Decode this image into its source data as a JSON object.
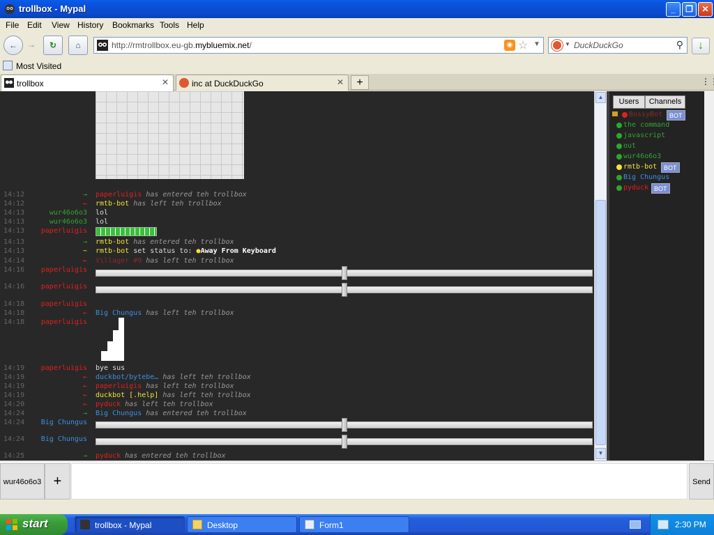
{
  "window": {
    "title": "trollbox - Mypal"
  },
  "menu": [
    "File",
    "Edit",
    "View",
    "History",
    "Bookmarks",
    "Tools",
    "Help"
  ],
  "url": {
    "prefix": "http://rmtrollbox.eu-gb.",
    "domain": "mybluemix.net",
    "suffix": "/"
  },
  "search": {
    "placeholder": "DuckDuckGo"
  },
  "bookmarks": {
    "most_visited": "Most Visited"
  },
  "tabs": [
    {
      "label": "trollbox",
      "active": true
    },
    {
      "label": "inc at DuckDuckGo",
      "active": false
    }
  ],
  "chat": {
    "messages": [
      {
        "time": "14:12",
        "arrow": "→",
        "nick": "paperluigis",
        "text": "has entered teh trollbox"
      },
      {
        "time": "14:12",
        "arrow": "←",
        "nick": "rmtb-bot",
        "text": "has left teh trollbox"
      },
      {
        "time": "14:13",
        "nick": "wur46o6o3",
        "text": "lol"
      },
      {
        "time": "14:13",
        "nick": "wur46o6o3",
        "text": "lol"
      },
      {
        "time": "14:13",
        "nick": "paperluigis",
        "text": ""
      },
      {
        "time": "14:13",
        "arrow": "→",
        "nick": "rmtb-bot",
        "text": "has entered teh trollbox"
      },
      {
        "time": "14:13",
        "arrow": "~",
        "nick": "rmtb-bot",
        "text": "set status to:",
        "status": "Away From Keyboard"
      },
      {
        "time": "14:14",
        "arrow": "←",
        "nick": "Villager #9",
        "text": "has left teh trollbox"
      },
      {
        "time": "14:16",
        "nick": "paperluigis",
        "text": ""
      },
      {
        "time": "14:16",
        "nick": "paperluigis",
        "text": ""
      },
      {
        "time": "14:18",
        "nick": "paperluigis",
        "text": ""
      },
      {
        "time": "14:18",
        "arrow": "←",
        "nick": "Big Chungus",
        "text": "has left teh trollbox"
      },
      {
        "time": "14:18",
        "nick": "paperluigis",
        "text": ""
      },
      {
        "time": "14:19",
        "nick": "paperluigis",
        "text": "bye sus"
      },
      {
        "time": "14:19",
        "arrow": "←",
        "nick": "duckbot/bytebe…",
        "text": "has left teh trollbox"
      },
      {
        "time": "14:19",
        "arrow": "←",
        "nick": "paperluigis",
        "text": "has left teh trollbox"
      },
      {
        "time": "14:19",
        "arrow": "←",
        "nick": "duckbot [.help]",
        "text": "has left teh trollbox"
      },
      {
        "time": "14:20",
        "arrow": "←",
        "nick": "pyduck",
        "text": "has left teh trollbox"
      },
      {
        "time": "14:24",
        "arrow": "→",
        "nick": "Big Chungus",
        "text": "has entered teh trollbox"
      },
      {
        "time": "14:24",
        "nick": "Big Chungus",
        "text": ""
      },
      {
        "time": "14:24",
        "nick": "Big Chungus",
        "text": ""
      },
      {
        "time": "14:25",
        "arrow": "→",
        "nick": "pyduck",
        "text": "has entered teh trollbox"
      }
    ],
    "sliders": [
      0.5,
      0.5,
      0.5,
      0.5
    ],
    "progress": 1.0
  },
  "side": {
    "tabs": [
      "Users",
      "Channels"
    ],
    "users": [
      {
        "name": "BossyBot",
        "badge": "BOT"
      },
      {
        "name": "the command"
      },
      {
        "name": "javascript"
      },
      {
        "name": "out"
      },
      {
        "name": "wur46o6o3"
      },
      {
        "name": "rmtb-bot",
        "badge": "BOT"
      },
      {
        "name": "Big Chungus"
      },
      {
        "name": "pyduck",
        "badge": "BOT"
      }
    ]
  },
  "bottom": {
    "nick": "wur46o6o3",
    "plus": "+",
    "send": "Send"
  },
  "taskbar": {
    "start": "start",
    "tasks": [
      "trollbox - Mypal",
      "Desktop",
      "Form1"
    ],
    "clock": "2:30 PM"
  }
}
